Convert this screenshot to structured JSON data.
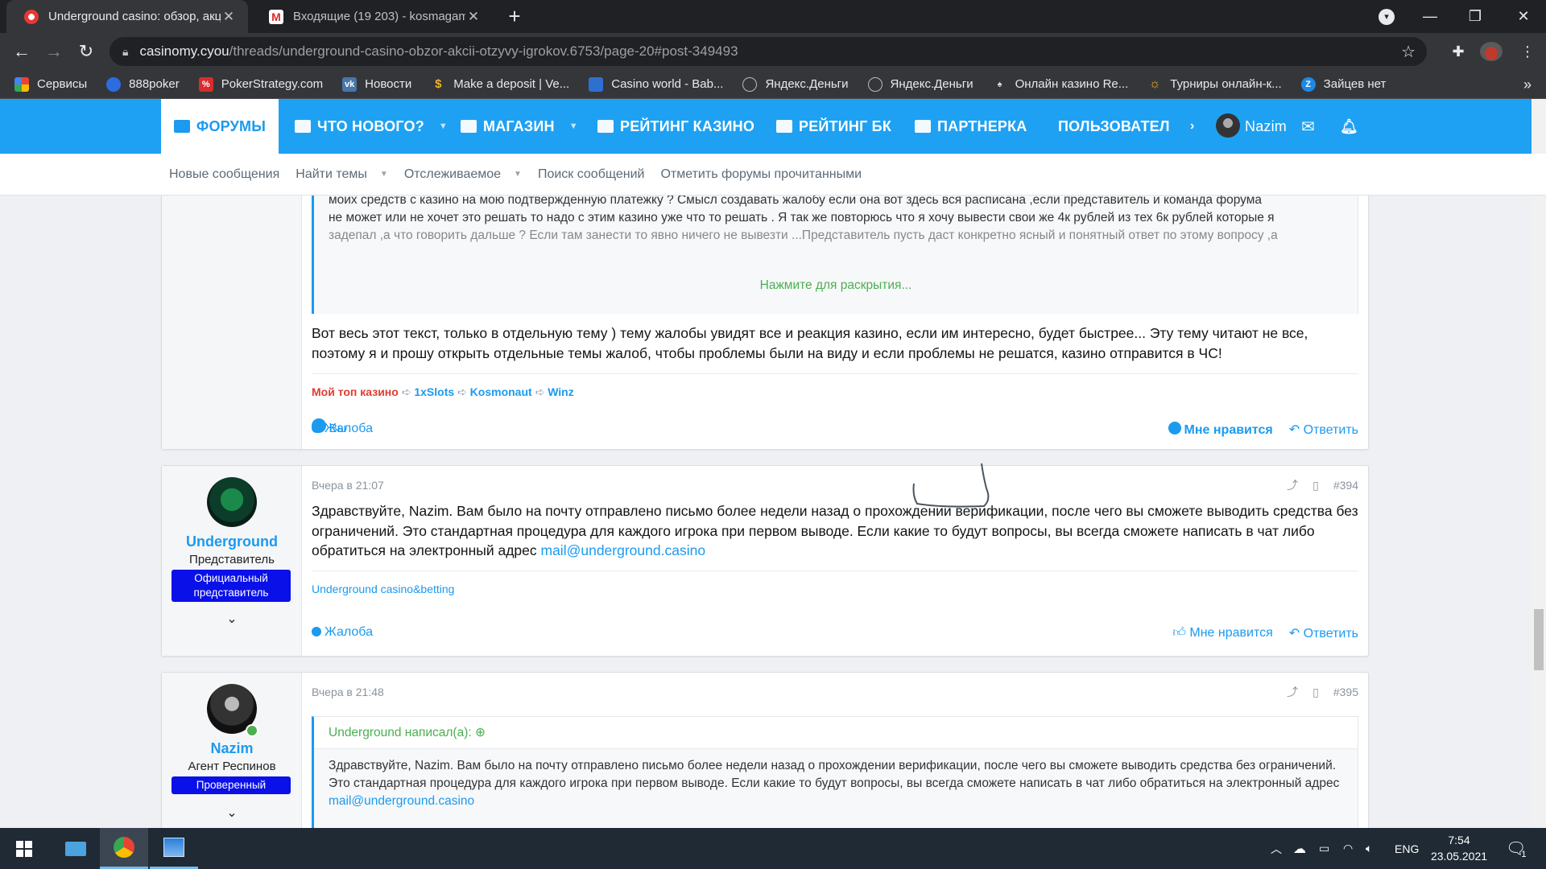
{
  "browser": {
    "tabs": [
      {
        "title": "Underground casino: обзор, акци",
        "active": true
      },
      {
        "title": "Входящие (19 203) - kosmagame",
        "active": false
      }
    ],
    "url_host": "casinomy.cyou",
    "url_path": "/threads/underground-casino-obzor-akcii-otzyvy-igrokov.6753/page-20#post-349493",
    "bookmarks": [
      {
        "label": "Сервисы",
        "icon": "apps-icon"
      },
      {
        "label": "888poker",
        "icon": "poker-icon"
      },
      {
        "label": "PokerStrategy.com",
        "icon": "percent-icon"
      },
      {
        "label": "Новости",
        "icon": "vk-icon"
      },
      {
        "label": "Make a deposit | Ve...",
        "icon": "dollar-icon"
      },
      {
        "label": "Casino world - Bab...",
        "icon": "blue-square-icon"
      },
      {
        "label": "Яндекс.Деньги",
        "icon": "globe-icon"
      },
      {
        "label": "Яндекс.Деньги",
        "icon": "globe-icon"
      },
      {
        "label": "Онлайн казино Re...",
        "icon": "joker-icon"
      },
      {
        "label": "Турниры онлайн-к...",
        "icon": "sun-icon"
      },
      {
        "label": "Зайцев нет",
        "icon": "z-icon"
      }
    ]
  },
  "forum_nav": {
    "items": [
      {
        "label": "ФОРУМЫ"
      },
      {
        "label": "ЧТО НОВОГО?"
      },
      {
        "label": "МАГАЗИН"
      },
      {
        "label": "РЕЙТИНГ КАЗИНО"
      },
      {
        "label": "РЕЙТИНГ БК"
      },
      {
        "label": "ПАРТНЕРКА"
      },
      {
        "label": "ПОЛЬЗОВАТЕЛ"
      }
    ],
    "username": "Nazim"
  },
  "sub_nav": {
    "items": [
      "Новые сообщения",
      "Найти темы",
      "Отслеживаемое",
      "Поиск сообщений",
      "Отметить форумы прочитанными"
    ]
  },
  "post1": {
    "quote_lines": [
      "моих средств с казино на мою подтвержденную платежку ? Смысл создавать жалобу если она вот здесь вся расписана ,если представитель и команда форума",
      "не может или не хочет это решать то надо с этим казино уже что то решать . Я так же повторюсь что я хочу вывести свои же 4к рублей из тех 6к рублей которые я",
      "задепал ,а что говорить дальше ? Если там занести то явно ничего не вывезти ...Представитель пусть даст конкретно ясный и понятный ответ по этому вопросу ,а"
    ],
    "expand_label": "Нажмите для раскрытия...",
    "text": "Вот весь этот текст, только в отдельную тему ) тему жалобы увидят все и реакция казино, если им интересно, будет быстрее... Эту тему читают не все, поэтому я и прошу открыть отдельные темы жалоб, чтобы проблемы были на виду и если проблемы не решатся, казино отправится в ЧС!",
    "sig_label": "Мой топ казино",
    "sig_links": [
      "1xSlots",
      "Kosmonaut",
      "Winz"
    ],
    "reactions": "Вы",
    "report": "Жалоба",
    "like": "Мне нравится",
    "reply": "Ответить"
  },
  "post2": {
    "author": "Underground",
    "role": "Представитель",
    "badge": "Официальный представитель",
    "time": "Вчера в 21:07",
    "number": "#394",
    "text": "Здравствуйте, Nazim. Вам было на почту отправлено письмо более недели назад о прохождении верификации, после чего вы сможете выводить средства без ограничений. Это стандартная процедура для каждого игрока при первом выводе. Если какие то будут вопросы, вы всегда сможете написать в чат либо обратиться на электронный адрес ",
    "email": "mail@underground.casino",
    "signature": "Underground casino&betting",
    "report": "Жалоба",
    "like": "Мне нравится",
    "reply": "Ответить"
  },
  "post3": {
    "author": "Nazim",
    "role": "Агент Респинов",
    "badge": "Проверенный",
    "time": "Вчера в 21:48",
    "number": "#395",
    "quote_head": "Underground написал(а):",
    "quote_text": "Здравствуйте, Nazim. Вам было на почту отправлено письмо более недели назад о прохождении верификации, после чего вы сможете выводить средства без ограничений. Это стандартная процедура для каждого игрока при первом выводе. Если какие то будут вопросы, вы всегда сможете написать в чат либо обратиться на электронный адрес ",
    "quote_email": "mail@underground.casino"
  },
  "taskbar": {
    "lang": "ENG",
    "time": "7:54",
    "date": "23.05.2021",
    "notifications": "1"
  },
  "colors": {
    "accent": "#1ea1f2",
    "badge_blue": "#0a10e8",
    "quote_green": "#4caf50",
    "sig_red": "#e03c31"
  }
}
